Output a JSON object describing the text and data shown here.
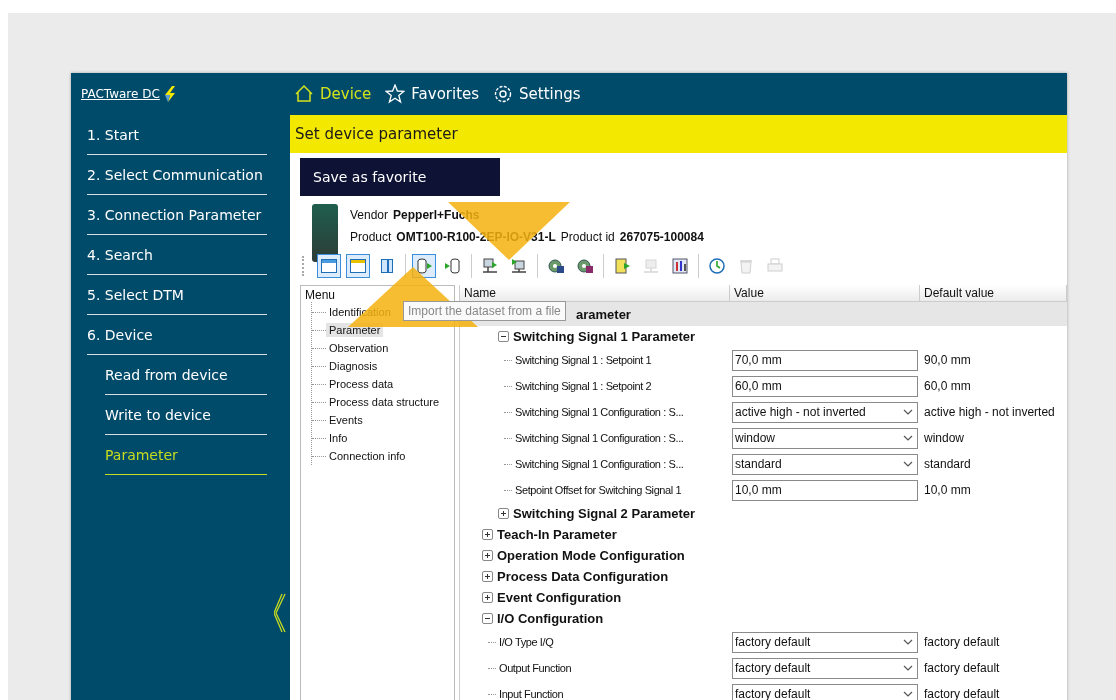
{
  "app": {
    "logo": "PACTware DC"
  },
  "nav": [
    {
      "label": "Device",
      "selected": true
    },
    {
      "label": "Favorites",
      "selected": false
    },
    {
      "label": "Settings",
      "selected": false
    }
  ],
  "sidebar": {
    "items": [
      {
        "label": "1. Start",
        "selected": false
      },
      {
        "label": "2. Select Communication",
        "selected": false
      },
      {
        "label": "3. Connection Parameter",
        "selected": false
      },
      {
        "label": "4. Search",
        "selected": false
      },
      {
        "label": "5. Select DTM",
        "selected": false
      },
      {
        "label": "6. Device",
        "selected": false,
        "children": [
          {
            "label": "Read from device",
            "selected": false
          },
          {
            "label": "Write to device",
            "selected": false
          },
          {
            "label": "Parameter",
            "selected": true
          }
        ]
      }
    ]
  },
  "page_title": "Set device parameter",
  "favorite_button": "Save as favorite",
  "device": {
    "vendor_label": "Vendor",
    "vendor": "Pepperl+Fuchs",
    "product_label": "Product",
    "product": "OMT100-R100-2EP-IO-V31-L",
    "product_id_label": "Product id",
    "product_id": "267075-100084"
  },
  "toolbar": [
    {
      "buttons": [
        {
          "selected": true,
          "disabled": false
        },
        {
          "selected": true,
          "disabled": false
        },
        {
          "selected": false,
          "disabled": false
        }
      ]
    },
    {
      "buttons": [
        {
          "selected": true,
          "disabled": false
        },
        {
          "selected": false,
          "disabled": false
        }
      ]
    },
    {
      "buttons": [
        {
          "selected": false,
          "disabled": false
        },
        {
          "selected": false,
          "disabled": false
        }
      ]
    },
    {
      "buttons": [
        {
          "selected": false,
          "disabled": false
        },
        {
          "selected": false,
          "disabled": false
        }
      ]
    },
    {
      "buttons": [
        {
          "selected": false,
          "disabled": false
        },
        {
          "selected": false,
          "disabled": true
        },
        {
          "selected": false,
          "disabled": false
        }
      ]
    },
    {
      "buttons": [
        {
          "selected": false,
          "disabled": false
        },
        {
          "selected": false,
          "disabled": true
        },
        {
          "selected": false,
          "disabled": true
        }
      ]
    }
  ],
  "tooltip": "Import the dataset from a file",
  "menu": {
    "title": "Menu",
    "items": [
      {
        "label": "Identification",
        "selected": false
      },
      {
        "label": "Parameter",
        "selected": true
      },
      {
        "label": "Observation",
        "selected": false
      },
      {
        "label": "Diagnosis",
        "selected": false
      },
      {
        "label": "Process data",
        "selected": false
      },
      {
        "label": "Process data structure",
        "selected": false
      },
      {
        "label": "Events",
        "selected": false
      },
      {
        "label": "Info",
        "selected": false
      },
      {
        "label": "Connection info",
        "selected": false
      }
    ]
  },
  "grid": {
    "columns": [
      "Name",
      "Value",
      "Default value"
    ],
    "rows": [
      {
        "kind": "category",
        "name": "arameter",
        "children": [
          {
            "kind": "group",
            "name": "Switching Signal 1 Parameter",
            "expanded": true,
            "children": [
              {
                "kind": "param",
                "name": "Switching Signal 1 : Setpoint 1",
                "value": {
                  "kind": "input",
                  "text": "70,0 mm"
                },
                "default": "90,0 mm"
              },
              {
                "kind": "param",
                "name": "Switching Signal 1 : Setpoint 2",
                "value": {
                  "kind": "input",
                  "text": "60,0 mm"
                },
                "default": "60,0 mm"
              },
              {
                "kind": "param",
                "name": "Switching Signal 1 Configuration : S...",
                "value": {
                  "kind": "dropdown",
                  "text": "active high - not inverted"
                },
                "default": "active high - not inverted"
              },
              {
                "kind": "param",
                "name": "Switching Signal 1 Configuration : S...",
                "value": {
                  "kind": "dropdown",
                  "text": "window"
                },
                "default": "window"
              },
              {
                "kind": "param",
                "name": "Switching Signal 1 Configuration : S...",
                "value": {
                  "kind": "dropdown",
                  "text": "standard"
                },
                "default": "standard"
              },
              {
                "kind": "param",
                "name": "Setpoint Offset for Switching Signal 1",
                "value": {
                  "kind": "input",
                  "text": "10,0 mm"
                },
                "default": "10,0 mm"
              }
            ]
          },
          {
            "kind": "group",
            "name": "Switching Signal 2 Parameter",
            "expanded": false
          }
        ]
      },
      {
        "kind": "group",
        "name": "Teach-In Parameter",
        "expanded": false
      },
      {
        "kind": "group",
        "name": "Operation Mode Configuration",
        "expanded": false
      },
      {
        "kind": "group",
        "name": "Process Data Configuration",
        "expanded": false
      },
      {
        "kind": "group",
        "name": "Event Configuration",
        "expanded": false
      },
      {
        "kind": "group",
        "name": "I/O Configuration",
        "expanded": true,
        "children": [
          {
            "kind": "param",
            "name": "I/O Type I/Q",
            "value": {
              "kind": "dropdown",
              "text": "factory default"
            },
            "default": "factory default"
          },
          {
            "kind": "param",
            "name": "Output Function",
            "value": {
              "kind": "dropdown",
              "text": "factory default"
            },
            "default": "factory default"
          },
          {
            "kind": "param",
            "name": "Input Function",
            "value": {
              "kind": "dropdown",
              "text": "factory default"
            },
            "default": "factory default"
          }
        ]
      }
    ]
  }
}
